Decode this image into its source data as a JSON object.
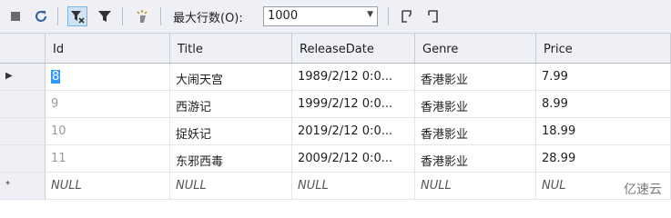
{
  "toolbar": {
    "max_rows_label": "最大行数(O):",
    "max_rows_value": "1000"
  },
  "grid": {
    "columns": [
      "Id",
      "Title",
      "ReleaseDate",
      "Genre",
      "Price"
    ],
    "rows": [
      {
        "id": "8",
        "title": "大闹天宫",
        "release": "1989/2/12 0:0...",
        "genre": "香港影业",
        "price": "7.99"
      },
      {
        "id": "9",
        "title": "西游记",
        "release": "1999/2/12 0:0...",
        "genre": "香港影业",
        "price": "8.99"
      },
      {
        "id": "10",
        "title": "捉妖记",
        "release": "2019/2/12 0:0...",
        "genre": "香港影业",
        "price": "18.99"
      },
      {
        "id": "11",
        "title": "东邪西毒",
        "release": "2009/2/12 0:0...",
        "genre": "香港影业",
        "price": "28.99"
      },
      {
        "id": "NULL",
        "title": "NULL",
        "release": "NULL",
        "genre": "NULL",
        "price": "NUL"
      }
    ],
    "row_markers": [
      "▶",
      "",
      "",
      "",
      "*"
    ]
  },
  "watermark": "亿速云"
}
